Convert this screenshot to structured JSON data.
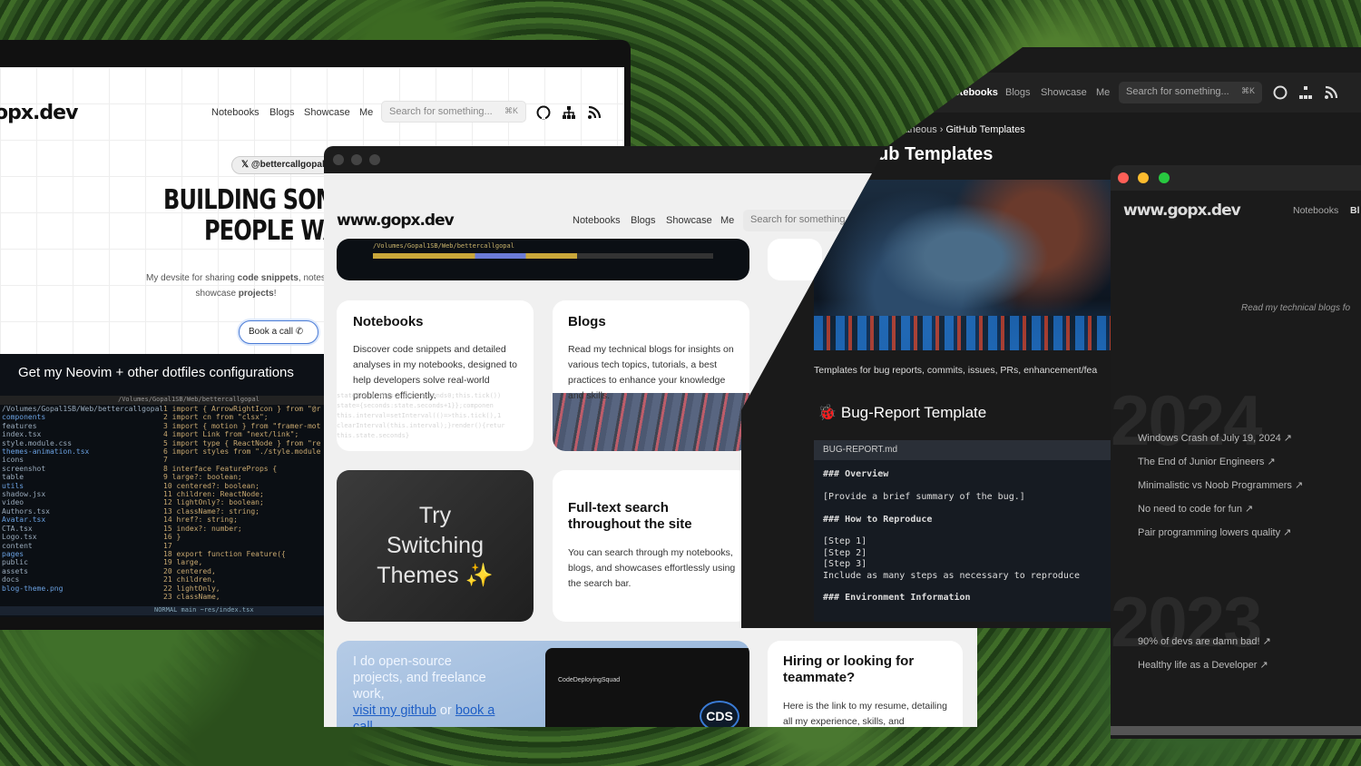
{
  "site_logo": "www.gopx.dev",
  "site_logo_partial": "opx.dev",
  "nav": [
    "Notebooks",
    "Blogs",
    "Showcase",
    "Me"
  ],
  "search": {
    "placeholder": "Search for something...",
    "placeholder_short": "Search for something",
    "shortcut": "⌘K"
  },
  "hero": {
    "handle": "@bettercallgopal",
    "title_line1": "BUILDING SOMI",
    "title_line2": "PEOPLE WA",
    "description_a": "My devsite for sharing ",
    "description_b": "code snippets",
    "description_c": ", notes",
    "description_d": "showcase ",
    "description_e": "projects",
    "description_f": "!",
    "cta": "Book a call"
  },
  "dotfiles_heading": "Get my Neovim + other dotfiles configurations",
  "terminal": {
    "path_bar": "/Volumes/Gopal1SB/Web/bettercallgopal",
    "status": "NORMAL  main  ~res/index.tsx",
    "tree": [
      "/Volumes/Gopal1SB/Web/bettercallgopal",
      "components",
      "features",
      "index.tsx",
      "style.module.css",
      "themes-animation.tsx",
      "icons",
      "screenshot",
      "table",
      "utils",
      "shadow.jsx",
      "video",
      "Authors.tsx",
      "Avatar.tsx",
      "CTA.tsx",
      "Logo.tsx",
      "content",
      "pages",
      "public",
      "assets",
      "docs",
      "blog-theme.png"
    ],
    "code": [
      "import { ArrowRightIcon } from \"@r",
      "import cn from \"clsx\";",
      "import { motion } from \"framer-mot",
      "import Link from \"next/link\";",
      "import type { ReactNode } from \"re",
      "import styles from \"./style.module",
      "",
      "interface FeatureProps {",
      "  large?: boolean;",
      "  centered?: boolean;",
      "  children: ReactNode;",
      "  lightOnly?: boolean;",
      "  className?: string;",
      "  href?: string;",
      "  index?: number;",
      "}",
      "",
      "export function Feature({",
      "  large,",
      "  centered,",
      "  children,",
      "  lightOnly,",
      "  className,"
    ]
  },
  "cards": {
    "notebooks_title": "Notebooks",
    "notebooks_text": "Discover code snippets and detailed analyses in my notebooks, designed to help developers solve real-world problems efficiently.",
    "blogs_title": "Blogs",
    "blogs_text": "Read my technical blogs for insights on various tech topics, tutorials, a best practices to enhance your knowledge and skills.",
    "themes_line1": "Try",
    "themes_line2": "Switching",
    "themes_line3": "Themes ✨",
    "search_title": "Full-text search throughout the site",
    "search_text": "You can search through my notebooks, blogs, and showcases effortlessly using the search bar.",
    "oss_text": "I do open-source projects, and freelance work,",
    "oss_link1": "visit my github",
    "oss_or": " or ",
    "oss_link2": "book a call",
    "cds_brand": "CodeDeployingSquad",
    "cds_badge": "CDS",
    "hiring_title": "Hiring or looking for teammate?",
    "hiring_text": "Here is the link to my resume, detailing all my experience, skills, and achievements."
  },
  "templates_page": {
    "breadcrumb_parent": "...laneous",
    "breadcrumb_current": "GitHub Templates",
    "title": "ub Templates",
    "description": "Templates for bug reports, commits, issues, PRs, enhancement/fea",
    "section_title": "Bug-Report Template",
    "file_name": "BUG-REPORT.md",
    "code_lines": [
      "### Overview",
      "",
      "[Provide a brief summary of the bug.]",
      "",
      "### How to Reproduce",
      "",
      "  [Step 1]",
      "  [Step 2]",
      "  [Step 3]",
      "  Include as many steps as necessary to reproduce",
      "",
      "### Environment Information"
    ]
  },
  "blog_page": {
    "logo": "www.gopx.dev",
    "nav_cut": "Bl",
    "tagline": "Read my technical blogs fo",
    "year_2024": "2024",
    "year_2023": "2023",
    "posts_2024": [
      "Windows Crash of July 19, 2024 ↗",
      "The End of Junior Engineers ↗",
      "Minimalistic vs Noob Programmers ↗",
      "No need to code for fun ↗",
      "Pair programming lowers quality ↗"
    ],
    "posts_2023": [
      "90% of devs are damn bad! ↗",
      "Healthy life as a Developer ↗"
    ]
  },
  "colors": {
    "accent_blue": "#1f5fc6",
    "dark_bg": "#1b1b1b",
    "mac_red": "#ff5f57",
    "mac_yellow": "#febc2e",
    "mac_green": "#28c840"
  },
  "icons": [
    "github-icon",
    "sitemap-icon",
    "rss-icon",
    "x-logo-icon",
    "phone-icon",
    "bug-icon"
  ]
}
